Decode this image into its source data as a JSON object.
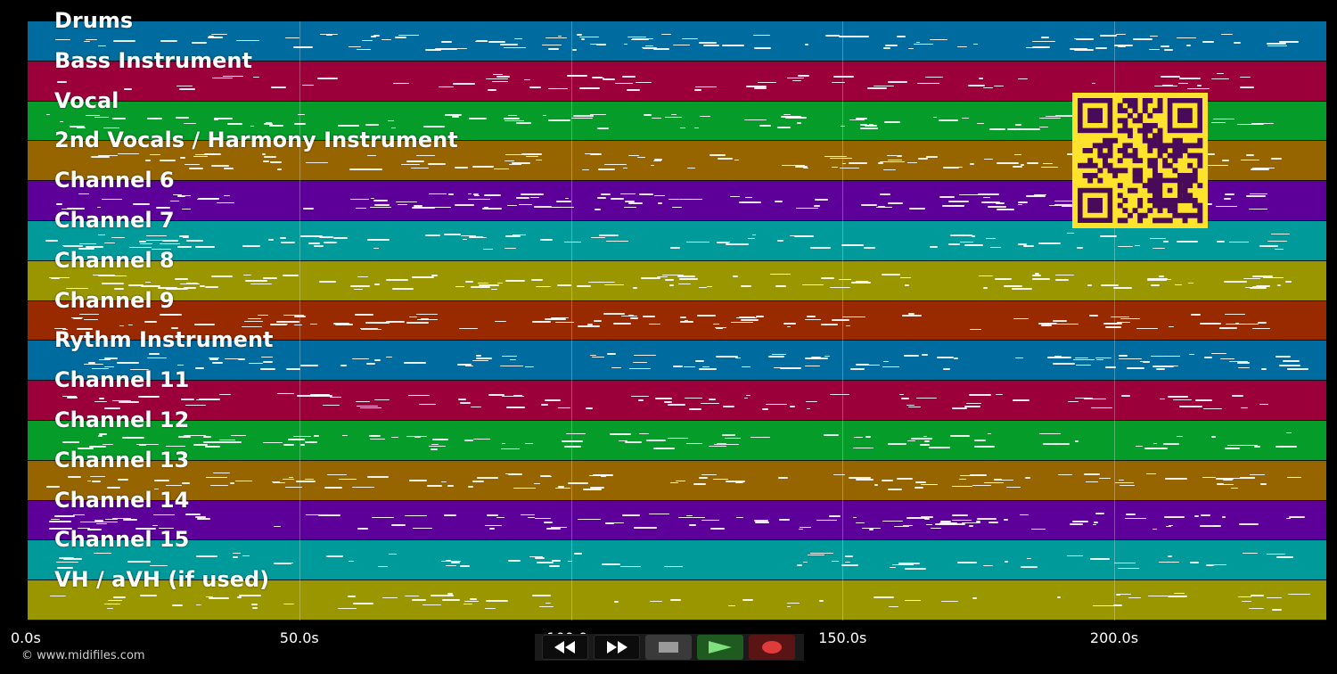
{
  "tracks": [
    {
      "label": "Drums",
      "color": "#006b9e"
    },
    {
      "label": "Bass Instrument",
      "color": "#9c003b"
    },
    {
      "label": "Vocal",
      "color": "#059c29"
    },
    {
      "label": "2nd Vocals / Harmony Instrument",
      "color": "#966500"
    },
    {
      "label": "Channel 6",
      "color": "#5d0099"
    },
    {
      "label": "Channel 7",
      "color": "#009a9a"
    },
    {
      "label": "Channel 8",
      "color": "#999600"
    },
    {
      "label": "Channel 9",
      "color": "#992a00"
    },
    {
      "label": "Rythm Instrument",
      "color": "#006b9e"
    },
    {
      "label": "Channel 11",
      "color": "#9c003b"
    },
    {
      "label": "Channel 12",
      "color": "#059c29"
    },
    {
      "label": "Channel 13",
      "color": "#966500"
    },
    {
      "label": "Channel 14",
      "color": "#5d0099"
    },
    {
      "label": "Channel 15",
      "color": "#009a9a"
    },
    {
      "label": "VH / aVH (if used)",
      "color": "#999600"
    }
  ],
  "time_axis": {
    "max_seconds": 239,
    "ticks": [
      {
        "value": 0,
        "label": "0.0s"
      },
      {
        "value": 50,
        "label": "50.0s"
      },
      {
        "value": 100,
        "label": "100.0s"
      },
      {
        "value": 150,
        "label": "150.0s"
      },
      {
        "value": 200,
        "label": "200.0s"
      }
    ]
  },
  "copyright": "© www.midifiles.com",
  "transport": {
    "rewind": "rewind-icon",
    "fast_forward": "fast-forward-icon",
    "stop": "stop-icon",
    "play": "play-icon",
    "record": "record-icon"
  },
  "qr_color": "#4a0a5a",
  "qr_bg": "#ffe22b"
}
